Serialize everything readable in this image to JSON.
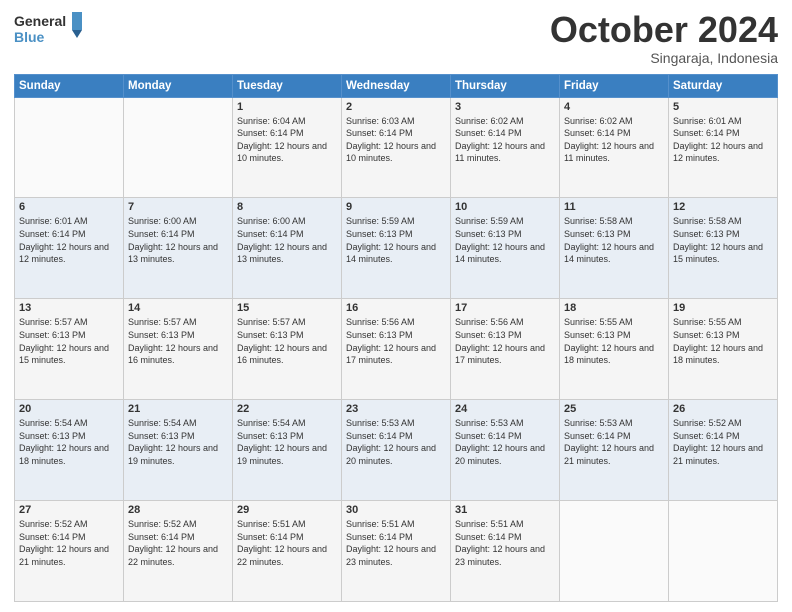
{
  "header": {
    "logo_line1": "General",
    "logo_line2": "Blue",
    "month_title": "October 2024",
    "location": "Singaraja, Indonesia"
  },
  "weekdays": [
    "Sunday",
    "Monday",
    "Tuesday",
    "Wednesday",
    "Thursday",
    "Friday",
    "Saturday"
  ],
  "rows": [
    [
      {
        "day": "",
        "sunrise": "",
        "sunset": "",
        "daylight": ""
      },
      {
        "day": "",
        "sunrise": "",
        "sunset": "",
        "daylight": ""
      },
      {
        "day": "1",
        "sunrise": "Sunrise: 6:04 AM",
        "sunset": "Sunset: 6:14 PM",
        "daylight": "Daylight: 12 hours and 10 minutes."
      },
      {
        "day": "2",
        "sunrise": "Sunrise: 6:03 AM",
        "sunset": "Sunset: 6:14 PM",
        "daylight": "Daylight: 12 hours and 10 minutes."
      },
      {
        "day": "3",
        "sunrise": "Sunrise: 6:02 AM",
        "sunset": "Sunset: 6:14 PM",
        "daylight": "Daylight: 12 hours and 11 minutes."
      },
      {
        "day": "4",
        "sunrise": "Sunrise: 6:02 AM",
        "sunset": "Sunset: 6:14 PM",
        "daylight": "Daylight: 12 hours and 11 minutes."
      },
      {
        "day": "5",
        "sunrise": "Sunrise: 6:01 AM",
        "sunset": "Sunset: 6:14 PM",
        "daylight": "Daylight: 12 hours and 12 minutes."
      }
    ],
    [
      {
        "day": "6",
        "sunrise": "Sunrise: 6:01 AM",
        "sunset": "Sunset: 6:14 PM",
        "daylight": "Daylight: 12 hours and 12 minutes."
      },
      {
        "day": "7",
        "sunrise": "Sunrise: 6:00 AM",
        "sunset": "Sunset: 6:14 PM",
        "daylight": "Daylight: 12 hours and 13 minutes."
      },
      {
        "day": "8",
        "sunrise": "Sunrise: 6:00 AM",
        "sunset": "Sunset: 6:14 PM",
        "daylight": "Daylight: 12 hours and 13 minutes."
      },
      {
        "day": "9",
        "sunrise": "Sunrise: 5:59 AM",
        "sunset": "Sunset: 6:13 PM",
        "daylight": "Daylight: 12 hours and 14 minutes."
      },
      {
        "day": "10",
        "sunrise": "Sunrise: 5:59 AM",
        "sunset": "Sunset: 6:13 PM",
        "daylight": "Daylight: 12 hours and 14 minutes."
      },
      {
        "day": "11",
        "sunrise": "Sunrise: 5:58 AM",
        "sunset": "Sunset: 6:13 PM",
        "daylight": "Daylight: 12 hours and 14 minutes."
      },
      {
        "day": "12",
        "sunrise": "Sunrise: 5:58 AM",
        "sunset": "Sunset: 6:13 PM",
        "daylight": "Daylight: 12 hours and 15 minutes."
      }
    ],
    [
      {
        "day": "13",
        "sunrise": "Sunrise: 5:57 AM",
        "sunset": "Sunset: 6:13 PM",
        "daylight": "Daylight: 12 hours and 15 minutes."
      },
      {
        "day": "14",
        "sunrise": "Sunrise: 5:57 AM",
        "sunset": "Sunset: 6:13 PM",
        "daylight": "Daylight: 12 hours and 16 minutes."
      },
      {
        "day": "15",
        "sunrise": "Sunrise: 5:57 AM",
        "sunset": "Sunset: 6:13 PM",
        "daylight": "Daylight: 12 hours and 16 minutes."
      },
      {
        "day": "16",
        "sunrise": "Sunrise: 5:56 AM",
        "sunset": "Sunset: 6:13 PM",
        "daylight": "Daylight: 12 hours and 17 minutes."
      },
      {
        "day": "17",
        "sunrise": "Sunrise: 5:56 AM",
        "sunset": "Sunset: 6:13 PM",
        "daylight": "Daylight: 12 hours and 17 minutes."
      },
      {
        "day": "18",
        "sunrise": "Sunrise: 5:55 AM",
        "sunset": "Sunset: 6:13 PM",
        "daylight": "Daylight: 12 hours and 18 minutes."
      },
      {
        "day": "19",
        "sunrise": "Sunrise: 5:55 AM",
        "sunset": "Sunset: 6:13 PM",
        "daylight": "Daylight: 12 hours and 18 minutes."
      }
    ],
    [
      {
        "day": "20",
        "sunrise": "Sunrise: 5:54 AM",
        "sunset": "Sunset: 6:13 PM",
        "daylight": "Daylight: 12 hours and 18 minutes."
      },
      {
        "day": "21",
        "sunrise": "Sunrise: 5:54 AM",
        "sunset": "Sunset: 6:13 PM",
        "daylight": "Daylight: 12 hours and 19 minutes."
      },
      {
        "day": "22",
        "sunrise": "Sunrise: 5:54 AM",
        "sunset": "Sunset: 6:13 PM",
        "daylight": "Daylight: 12 hours and 19 minutes."
      },
      {
        "day": "23",
        "sunrise": "Sunrise: 5:53 AM",
        "sunset": "Sunset: 6:14 PM",
        "daylight": "Daylight: 12 hours and 20 minutes."
      },
      {
        "day": "24",
        "sunrise": "Sunrise: 5:53 AM",
        "sunset": "Sunset: 6:14 PM",
        "daylight": "Daylight: 12 hours and 20 minutes."
      },
      {
        "day": "25",
        "sunrise": "Sunrise: 5:53 AM",
        "sunset": "Sunset: 6:14 PM",
        "daylight": "Daylight: 12 hours and 21 minutes."
      },
      {
        "day": "26",
        "sunrise": "Sunrise: 5:52 AM",
        "sunset": "Sunset: 6:14 PM",
        "daylight": "Daylight: 12 hours and 21 minutes."
      }
    ],
    [
      {
        "day": "27",
        "sunrise": "Sunrise: 5:52 AM",
        "sunset": "Sunset: 6:14 PM",
        "daylight": "Daylight: 12 hours and 21 minutes."
      },
      {
        "day": "28",
        "sunrise": "Sunrise: 5:52 AM",
        "sunset": "Sunset: 6:14 PM",
        "daylight": "Daylight: 12 hours and 22 minutes."
      },
      {
        "day": "29",
        "sunrise": "Sunrise: 5:51 AM",
        "sunset": "Sunset: 6:14 PM",
        "daylight": "Daylight: 12 hours and 22 minutes."
      },
      {
        "day": "30",
        "sunrise": "Sunrise: 5:51 AM",
        "sunset": "Sunset: 6:14 PM",
        "daylight": "Daylight: 12 hours and 23 minutes."
      },
      {
        "day": "31",
        "sunrise": "Sunrise: 5:51 AM",
        "sunset": "Sunset: 6:14 PM",
        "daylight": "Daylight: 12 hours and 23 minutes."
      },
      {
        "day": "",
        "sunrise": "",
        "sunset": "",
        "daylight": ""
      },
      {
        "day": "",
        "sunrise": "",
        "sunset": "",
        "daylight": ""
      }
    ]
  ]
}
